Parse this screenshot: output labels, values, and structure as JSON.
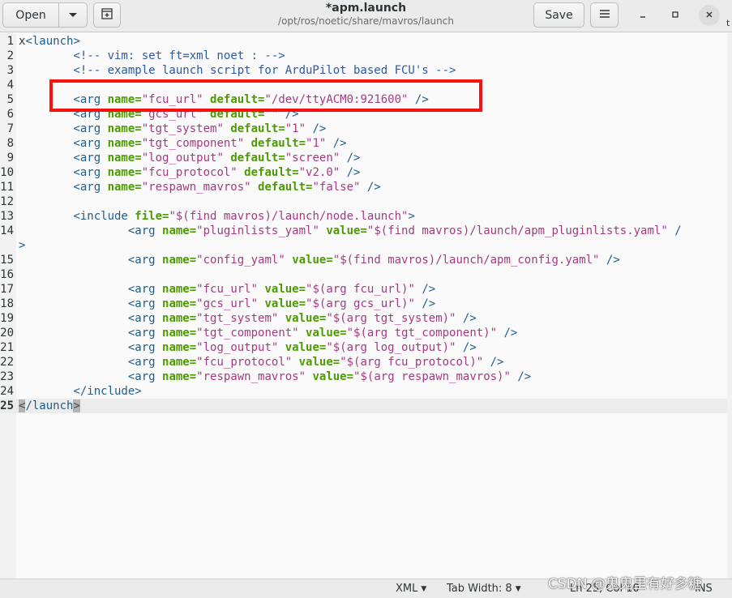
{
  "header": {
    "open_label": "Open",
    "open_arrow_icon": "chevron-down-icon",
    "new_tab_icon": "new-tab-icon",
    "title": "*apm.launch",
    "path": "/opt/ros/noetic/share/mavros/launch",
    "save_label": "Save",
    "menu_icon": "hamburger-icon",
    "edge_fragment": "t"
  },
  "editor": {
    "current_line": 25,
    "highlight_color": "#ff1010",
    "lines": [
      {
        "n": "1",
        "segs": [
          {
            "c": "t-ent",
            "t": "x"
          },
          {
            "c": "t-tag",
            "t": "<launch>"
          }
        ]
      },
      {
        "n": "2",
        "segs": [
          {
            "c": "t-com",
            "t": "        <!-- vim: set ft=xml noet : -->"
          }
        ]
      },
      {
        "n": "3",
        "segs": [
          {
            "c": "t-com",
            "t": "        <!-- example launch script for ArduPilot based FCU's -->"
          }
        ]
      },
      {
        "n": "4",
        "segs": []
      },
      {
        "n": "5",
        "segs": [
          {
            "c": "t-tag",
            "t": "        <arg "
          },
          {
            "c": "t-attr",
            "t": "name="
          },
          {
            "c": "t-str",
            "t": "\"fcu_url\" "
          },
          {
            "c": "t-attr",
            "t": "default="
          },
          {
            "c": "t-str",
            "t": "\"/dev/ttyACM0:921600\""
          },
          {
            "c": "t-tag",
            "t": " />"
          }
        ]
      },
      {
        "n": "6",
        "segs": [
          {
            "c": "t-tag",
            "t": "        <arg "
          },
          {
            "c": "t-attr",
            "t": "name="
          },
          {
            "c": "t-str",
            "t": "\"gcs_url\" "
          },
          {
            "c": "t-attr",
            "t": "default="
          },
          {
            "c": "t-str",
            "t": "\"\""
          },
          {
            "c": "t-tag",
            "t": " />"
          }
        ]
      },
      {
        "n": "7",
        "segs": [
          {
            "c": "t-tag",
            "t": "        <arg "
          },
          {
            "c": "t-attr",
            "t": "name="
          },
          {
            "c": "t-str",
            "t": "\"tgt_system\" "
          },
          {
            "c": "t-attr",
            "t": "default="
          },
          {
            "c": "t-str",
            "t": "\"1\""
          },
          {
            "c": "t-tag",
            "t": " />"
          }
        ]
      },
      {
        "n": "8",
        "segs": [
          {
            "c": "t-tag",
            "t": "        <arg "
          },
          {
            "c": "t-attr",
            "t": "name="
          },
          {
            "c": "t-str",
            "t": "\"tgt_component\" "
          },
          {
            "c": "t-attr",
            "t": "default="
          },
          {
            "c": "t-str",
            "t": "\"1\""
          },
          {
            "c": "t-tag",
            "t": " />"
          }
        ]
      },
      {
        "n": "9",
        "segs": [
          {
            "c": "t-tag",
            "t": "        <arg "
          },
          {
            "c": "t-attr",
            "t": "name="
          },
          {
            "c": "t-str",
            "t": "\"log_output\" "
          },
          {
            "c": "t-attr",
            "t": "default="
          },
          {
            "c": "t-str",
            "t": "\"screen\""
          },
          {
            "c": "t-tag",
            "t": " />"
          }
        ]
      },
      {
        "n": "10",
        "segs": [
          {
            "c": "t-tag",
            "t": "        <arg "
          },
          {
            "c": "t-attr",
            "t": "name="
          },
          {
            "c": "t-str",
            "t": "\"fcu_protocol\" "
          },
          {
            "c": "t-attr",
            "t": "default="
          },
          {
            "c": "t-str",
            "t": "\"v2.0\""
          },
          {
            "c": "t-tag",
            "t": " />"
          }
        ]
      },
      {
        "n": "11",
        "segs": [
          {
            "c": "t-tag",
            "t": "        <arg "
          },
          {
            "c": "t-attr",
            "t": "name="
          },
          {
            "c": "t-str",
            "t": "\"respawn_mavros\" "
          },
          {
            "c": "t-attr",
            "t": "default="
          },
          {
            "c": "t-str",
            "t": "\"false\""
          },
          {
            "c": "t-tag",
            "t": " />"
          }
        ]
      },
      {
        "n": "12",
        "segs": []
      },
      {
        "n": "13",
        "segs": [
          {
            "c": "t-tag",
            "t": "        <include "
          },
          {
            "c": "t-attr",
            "t": "file="
          },
          {
            "c": "t-str",
            "t": "\"$(find mavros)/launch/node.launch\""
          },
          {
            "c": "t-tag",
            "t": ">"
          }
        ]
      },
      {
        "n": "14",
        "segs": [
          {
            "c": "t-tag",
            "t": "                <arg "
          },
          {
            "c": "t-attr",
            "t": "name="
          },
          {
            "c": "t-str",
            "t": "\"pluginlists_yaml\" "
          },
          {
            "c": "t-attr",
            "t": "value="
          },
          {
            "c": "t-str",
            "t": "\"$(find mavros)/launch/apm_pluginlists.yaml\""
          },
          {
            "c": "t-tag",
            "t": " /"
          }
        ]
      },
      {
        "n": "",
        "segs": [
          {
            "c": "t-tag",
            "t": ">"
          }
        ]
      },
      {
        "n": "15",
        "segs": [
          {
            "c": "t-tag",
            "t": "                <arg "
          },
          {
            "c": "t-attr",
            "t": "name="
          },
          {
            "c": "t-str",
            "t": "\"config_yaml\" "
          },
          {
            "c": "t-attr",
            "t": "value="
          },
          {
            "c": "t-str",
            "t": "\"$(find mavros)/launch/apm_config.yaml\""
          },
          {
            "c": "t-tag",
            "t": " />"
          }
        ]
      },
      {
        "n": "16",
        "segs": []
      },
      {
        "n": "17",
        "segs": [
          {
            "c": "t-tag",
            "t": "                <arg "
          },
          {
            "c": "t-attr",
            "t": "name="
          },
          {
            "c": "t-str",
            "t": "\"fcu_url\" "
          },
          {
            "c": "t-attr",
            "t": "value="
          },
          {
            "c": "t-str",
            "t": "\"$(arg fcu_url)\""
          },
          {
            "c": "t-tag",
            "t": " />"
          }
        ]
      },
      {
        "n": "18",
        "segs": [
          {
            "c": "t-tag",
            "t": "                <arg "
          },
          {
            "c": "t-attr",
            "t": "name="
          },
          {
            "c": "t-str",
            "t": "\"gcs_url\" "
          },
          {
            "c": "t-attr",
            "t": "value="
          },
          {
            "c": "t-str",
            "t": "\"$(arg gcs_url)\""
          },
          {
            "c": "t-tag",
            "t": " />"
          }
        ]
      },
      {
        "n": "19",
        "segs": [
          {
            "c": "t-tag",
            "t": "                <arg "
          },
          {
            "c": "t-attr",
            "t": "name="
          },
          {
            "c": "t-str",
            "t": "\"tgt_system\" "
          },
          {
            "c": "t-attr",
            "t": "value="
          },
          {
            "c": "t-str",
            "t": "\"$(arg tgt_system)\""
          },
          {
            "c": "t-tag",
            "t": " />"
          }
        ]
      },
      {
        "n": "20",
        "segs": [
          {
            "c": "t-tag",
            "t": "                <arg "
          },
          {
            "c": "t-attr",
            "t": "name="
          },
          {
            "c": "t-str",
            "t": "\"tgt_component\" "
          },
          {
            "c": "t-attr",
            "t": "value="
          },
          {
            "c": "t-str",
            "t": "\"$(arg tgt_component)\""
          },
          {
            "c": "t-tag",
            "t": " />"
          }
        ]
      },
      {
        "n": "21",
        "segs": [
          {
            "c": "t-tag",
            "t": "                <arg "
          },
          {
            "c": "t-attr",
            "t": "name="
          },
          {
            "c": "t-str",
            "t": "\"log_output\" "
          },
          {
            "c": "t-attr",
            "t": "value="
          },
          {
            "c": "t-str",
            "t": "\"$(arg log_output)\""
          },
          {
            "c": "t-tag",
            "t": " />"
          }
        ]
      },
      {
        "n": "22",
        "segs": [
          {
            "c": "t-tag",
            "t": "                <arg "
          },
          {
            "c": "t-attr",
            "t": "name="
          },
          {
            "c": "t-str",
            "t": "\"fcu_protocol\" "
          },
          {
            "c": "t-attr",
            "t": "value="
          },
          {
            "c": "t-str",
            "t": "\"$(arg fcu_protocol)\""
          },
          {
            "c": "t-tag",
            "t": " />"
          }
        ]
      },
      {
        "n": "23",
        "segs": [
          {
            "c": "t-tag",
            "t": "                <arg "
          },
          {
            "c": "t-attr",
            "t": "name="
          },
          {
            "c": "t-str",
            "t": "\"respawn_mavros\" "
          },
          {
            "c": "t-attr",
            "t": "value="
          },
          {
            "c": "t-str",
            "t": "\"$(arg respawn_mavros)\""
          },
          {
            "c": "t-tag",
            "t": " />"
          }
        ]
      },
      {
        "n": "24",
        "segs": [
          {
            "c": "t-tag",
            "t": "        </include>"
          }
        ]
      },
      {
        "n": "25",
        "segs": [
          {
            "c": "bracket-hl",
            "t": "<"
          },
          {
            "c": "t-tag",
            "t": "/launch"
          },
          {
            "c": "bracket-hl",
            "t": ">"
          }
        ]
      }
    ]
  },
  "statusbar": {
    "language": "XML",
    "tab_width": "Tab Width: 8",
    "position": "Ln 25, Col 10",
    "mode": "INS"
  },
  "watermark": "CSDN @鬼鬼里有好多糖"
}
